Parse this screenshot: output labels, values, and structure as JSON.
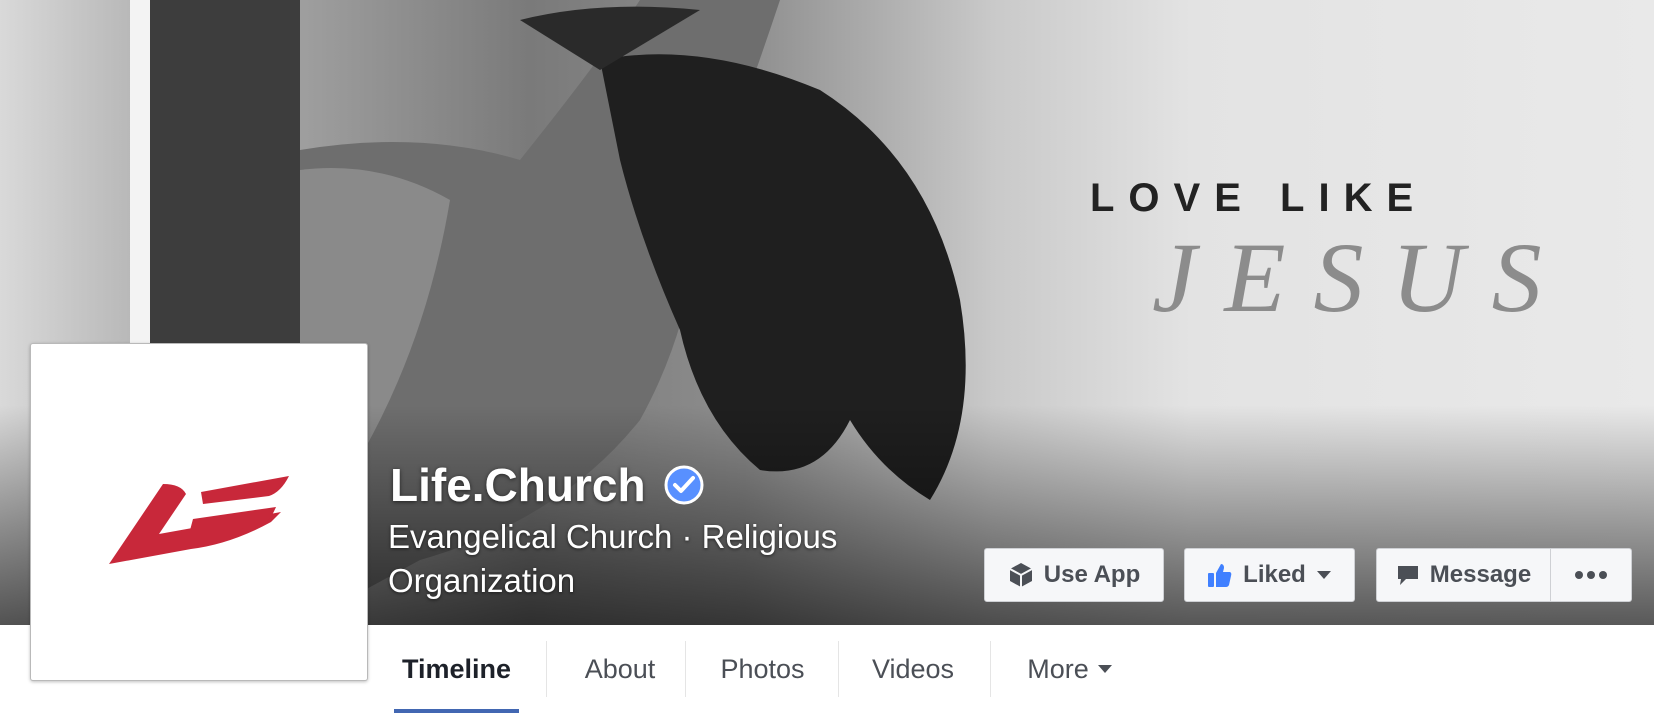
{
  "cover": {
    "tagline_line1": "LOVE LIKE",
    "tagline_line2": "JESUS"
  },
  "profile": {
    "logo_icon": "life-church-logo",
    "logo_color": "#c8283a"
  },
  "page": {
    "name": "Life.Church",
    "verified_icon": "verified-badge-icon",
    "verified_color": "#5890ff",
    "category": "Evangelical Church · Religious Organization"
  },
  "actions": {
    "use_app": "Use App",
    "liked": "Liked",
    "message": "Message",
    "more_icon": "ellipsis-icon"
  },
  "tabs": [
    {
      "label": "Timeline",
      "active": true
    },
    {
      "label": "About"
    },
    {
      "label": "Photos"
    },
    {
      "label": "Videos"
    },
    {
      "label": "More"
    }
  ],
  "colors": {
    "accent": "#4267b2",
    "like_blue": "#4080ff"
  }
}
